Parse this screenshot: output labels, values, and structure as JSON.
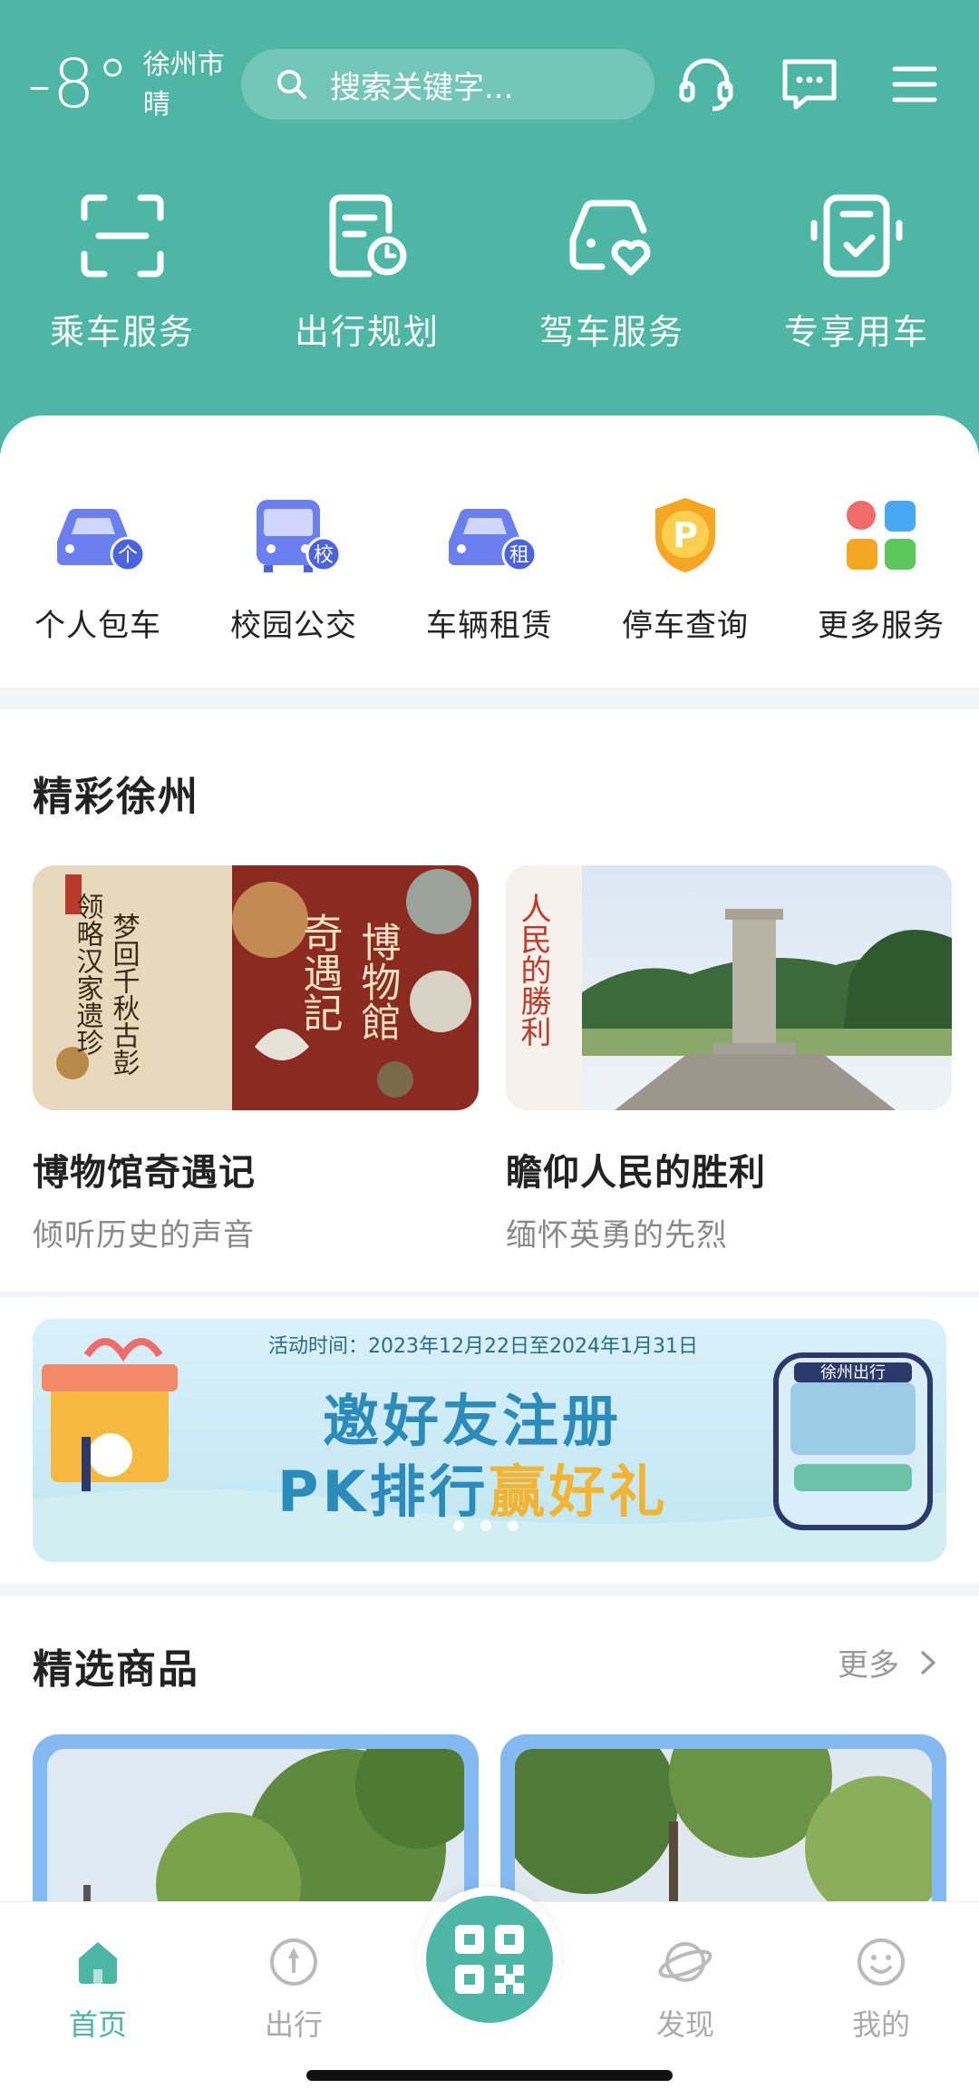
{
  "header": {
    "temperature": "-8°",
    "city": "徐州市",
    "weather": "晴",
    "search_placeholder": "搜索关键字..."
  },
  "quick_actions": [
    {
      "label": "乘车服务",
      "icon": "scan-icon"
    },
    {
      "label": "出行规划",
      "icon": "trip-plan-icon"
    },
    {
      "label": "驾车服务",
      "icon": "car-heart-icon"
    },
    {
      "label": "专享用车",
      "icon": "phone-car-icon"
    }
  ],
  "services": [
    {
      "label": "个人包车",
      "icon": "car-icon",
      "badge": "个"
    },
    {
      "label": "校园公交",
      "icon": "bus-icon",
      "badge": "校"
    },
    {
      "label": "车辆租赁",
      "icon": "car-icon",
      "badge": "租"
    },
    {
      "label": "停车查询",
      "icon": "parking-icon",
      "badge": "P"
    },
    {
      "label": "更多服务",
      "icon": "grid-icon",
      "badge": ""
    }
  ],
  "featured": {
    "title": "精彩徐州",
    "cards": [
      {
        "title": "博物馆奇遇记",
        "subtitle": "倾听历史的声音",
        "img_text_a": "领略汉家遗珍",
        "img_text_b": "梦回千秋古彭",
        "img_text_c": "奇遇記",
        "img_text_d": "博物館"
      },
      {
        "title": "瞻仰人民的胜利",
        "subtitle": "缅怀英勇的先烈",
        "img_text_a": "人民的勝利"
      }
    ]
  },
  "banner": {
    "date": "活动时间：2023年12月22日至2024年1月31日",
    "line1": "邀好友注册",
    "line2_a": "PK排行",
    "line2_b": "赢好礼",
    "bus_sign": "徐州出行"
  },
  "products": {
    "title": "精选商品",
    "more": "更多"
  },
  "tabbar": [
    {
      "label": "首页",
      "active": true
    },
    {
      "label": "出行",
      "active": false
    },
    {
      "label": "发现",
      "active": false
    },
    {
      "label": "我的",
      "active": false
    }
  ],
  "colors": {
    "brand": "#4db6a5",
    "service_blue": "#6a7ff0",
    "parking_orange": "#f5a623"
  }
}
